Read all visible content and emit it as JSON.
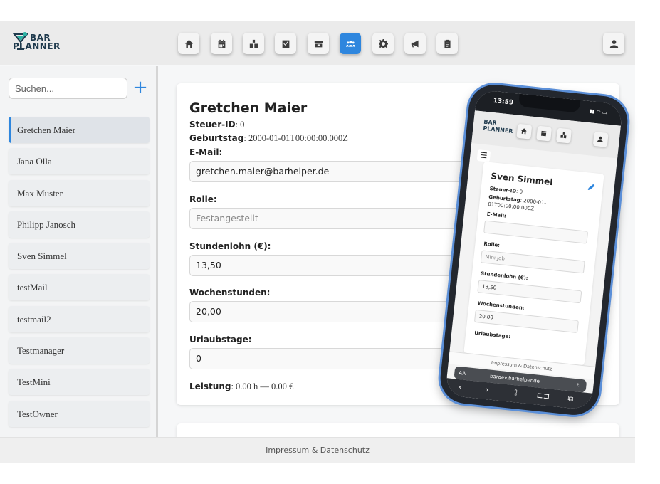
{
  "app": {
    "logo_line1": "BAR",
    "logo_line2": "PLANNER",
    "nav_icons": [
      "home-icon",
      "calendar-icon",
      "staff-icon",
      "checklist-icon",
      "inventory-icon",
      "employees-icon",
      "settings-icon",
      "announcements-icon",
      "clipboard-icon"
    ],
    "active_nav": "employees-icon",
    "profile_icon": "user-icon",
    "accent_color": "#2e86de"
  },
  "sidebar": {
    "search_placeholder": "Suchen...",
    "add_label": "+",
    "employees": [
      "Gretchen Maier",
      "Jana Olla",
      "Max Muster",
      "Philipp Janosch",
      "Sven Simmel",
      "testMail",
      "testmail2",
      "Testmanager",
      "TestMini",
      "TestOwner"
    ],
    "selected": "Gretchen Maier"
  },
  "detail": {
    "name": "Gretchen Maier",
    "tax_label": "Steuer-ID",
    "tax_value": ": 0",
    "birthday_label": "Geburtstag",
    "birthday_value": ": 2000-01-01T00:00:00.000Z",
    "email_label": "E-Mail:",
    "email_value": "gretchen.maier@barhelper.de",
    "role_label": "Rolle:",
    "role_value": "Festangestellt",
    "wage_label": "Stundenlohn (€):",
    "wage_value": "13,50",
    "hours_label": "Wochenstunden:",
    "hours_value": "20,00",
    "vacation_label": "Urlaubstage:",
    "vacation_value": "0",
    "performance_label": "Leistung",
    "performance_value": ": 0.00 h — 0.00 €"
  },
  "footer": {
    "text": "Impressum & Datenschutz"
  },
  "phone": {
    "time": "13:59",
    "logo_line1": "BAR",
    "logo_line2": "PLANNER",
    "menu_icon": "☰",
    "name": "Sven Simmel",
    "tax": "Steuer-ID",
    "tax_value": ": 0",
    "birthday": "Geburtstag",
    "birthday_value": ": 2000-01-",
    "birthday_value2": "01T00:00:00.000Z",
    "email_label": "E-Mail:",
    "role_label": "Rolle:",
    "role_value": "Mini Job",
    "wage_label": "Stundenlohn (€):",
    "wage_value": "13,50",
    "hours_label": "Wochenstunden:",
    "hours_value": "20,00",
    "vacation_label": "Urlaubstage:",
    "footer": "Impressum & Datenschutz",
    "browser_aa": "AA",
    "browser_url": "bardev.barhelper.de",
    "browser_reload": "↻",
    "tb_back": "‹",
    "tb_fwd": "›",
    "tb_share": "⇪",
    "tb_book": "⊏⊐",
    "tb_tabs": "⧉"
  }
}
